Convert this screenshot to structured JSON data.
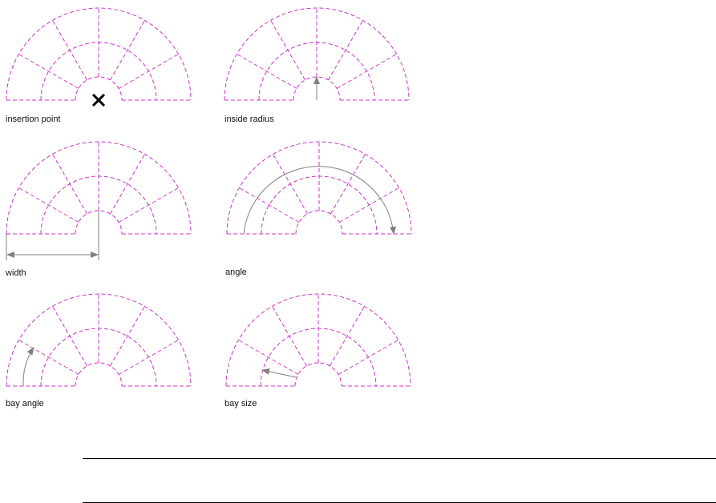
{
  "colors": {
    "outline": "#cc33cc",
    "dimension": "#808080",
    "marker": "#000000",
    "rule": "#000000"
  },
  "figures": [
    {
      "id": "insertion-point",
      "label": "insertion point",
      "annotation": "insertion-point-marker"
    },
    {
      "id": "inside-radius",
      "label": "inside radius",
      "annotation": "inside-radius-arrow"
    },
    {
      "id": "width",
      "label": "width",
      "annotation": "width-dimension"
    },
    {
      "id": "angle",
      "label": "angle",
      "annotation": "angle-arc-arrow"
    },
    {
      "id": "bay-angle",
      "label": "bay angle",
      "annotation": "bay-angle-arc-arrow"
    },
    {
      "id": "bay-size",
      "label": "bay size",
      "annotation": "bay-size-arrow"
    }
  ]
}
